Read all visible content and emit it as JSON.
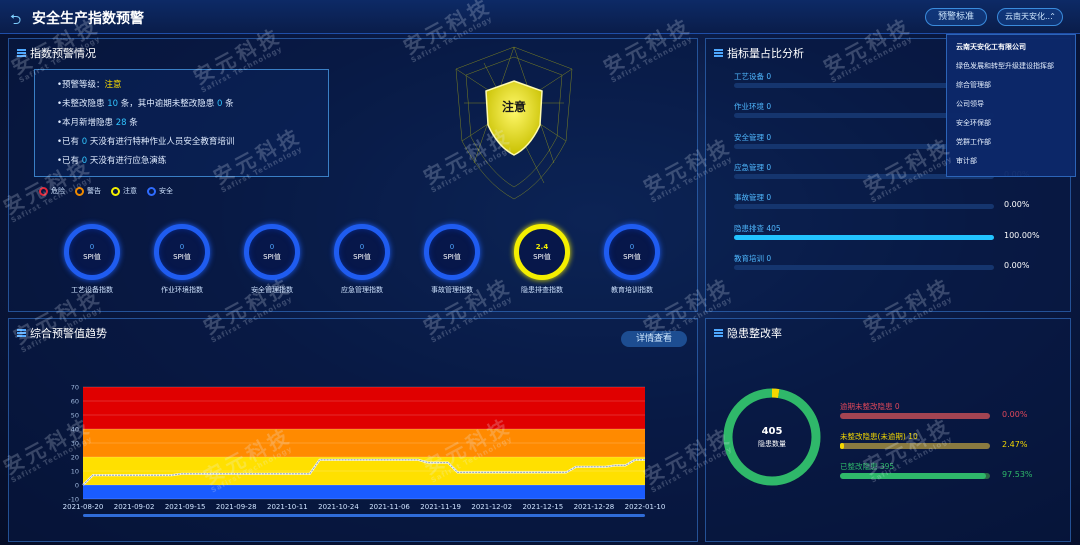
{
  "header": {
    "title": "安全生产指数预警",
    "standard_button": "预警标准",
    "company_selected": "云南天安化..."
  },
  "dropdown": {
    "items": [
      "云南天安化工有限公司",
      "绿色发展和转型升级建设指挥部",
      "综合管理部",
      "公司领导",
      "安全环保部",
      "党群工作部",
      "审计部"
    ]
  },
  "warning": {
    "title": "指数预警情况",
    "level_label": "•预警等级：",
    "level_value": "注意",
    "line2_pre": "•未整改隐患 ",
    "line2_v1": "10",
    "line2_mid": " 条，其中逾期未整改隐患 ",
    "line2_v2": "0",
    "line2_post": " 条",
    "line3_pre": "•本月新增隐患 ",
    "line3_v": "28",
    "line3_post": " 条",
    "line4_pre": "•已有 ",
    "line4_v": "0",
    "line4_post": " 天没有进行特种作业人员安全教育培训",
    "line5_pre": "•已有 ",
    "line5_v": "0",
    "line5_post": " 天没有进行应急演练",
    "shield_text": "注意",
    "legend": [
      {
        "label": "危险",
        "color": "#e0283a"
      },
      {
        "label": "警告",
        "color": "#f08a00"
      },
      {
        "label": "注意",
        "color": "#f4ef00"
      },
      {
        "label": "安全",
        "color": "#2f6cff"
      }
    ],
    "unit_label": "SPI值",
    "gauges": [
      {
        "label": "工艺设备指数",
        "value": "0"
      },
      {
        "label": "作业环境指数",
        "value": "0"
      },
      {
        "label": "安全管理指数",
        "value": "0"
      },
      {
        "label": "应急管理指数",
        "value": "0"
      },
      {
        "label": "事故管理指数",
        "value": "0"
      },
      {
        "label": "隐患排查指数",
        "value": "2.4"
      },
      {
        "label": "教育培训指数",
        "value": "0"
      }
    ]
  },
  "indicator": {
    "title": "指标量占比分析",
    "rows": [
      {
        "name": "工艺设备 0",
        "pct": "",
        "fill": 0
      },
      {
        "name": "作业环境 0",
        "pct": "",
        "fill": 0
      },
      {
        "name": "安全管理 0",
        "pct": "",
        "fill": 0
      },
      {
        "name": "应急管理 0",
        "pct": "0.00%",
        "fill": 0
      },
      {
        "name": "事故管理 0",
        "pct": "0.00%",
        "fill": 0
      },
      {
        "name": "隐患排查 405",
        "pct": "100.00%",
        "fill": 1
      },
      {
        "name": "教育培训 0",
        "pct": "0.00%",
        "fill": 0
      }
    ]
  },
  "trend": {
    "title": "综合预警值趋势",
    "detail_button": "详情查看"
  },
  "chart_data": {
    "type": "line",
    "x": [
      "2021-08-20",
      "2021-09-02",
      "2021-09-15",
      "2021-09-28",
      "2021-10-11",
      "2021-10-24",
      "2021-11-06",
      "2021-11-19",
      "2021-12-02",
      "2021-12-15",
      "2021-12-28",
      "2022-01-10"
    ],
    "ylim": [
      -10,
      70
    ],
    "yticks": [
      -10,
      0,
      10,
      20,
      30,
      40,
      50,
      60,
      70
    ],
    "bands": [
      {
        "from": -10,
        "to": 0,
        "color": "#1a5cff"
      },
      {
        "from": 0,
        "to": 20,
        "color": "#ffe000"
      },
      {
        "from": 20,
        "to": 40,
        "color": "#ff8a00"
      },
      {
        "from": 40,
        "to": 70,
        "color": "#e00000"
      }
    ],
    "series": [
      {
        "values": [
          0,
          7,
          7,
          7,
          7,
          7,
          7,
          7,
          7,
          7,
          8,
          8,
          8,
          8,
          8,
          8,
          8,
          8,
          8,
          8,
          8,
          8,
          8,
          8,
          18,
          18,
          18,
          18,
          18,
          18,
          18,
          18,
          18,
          18,
          18,
          16,
          16,
          16,
          9,
          9,
          9,
          9,
          9,
          9,
          9,
          9,
          9,
          9,
          9,
          9,
          13,
          13,
          13,
          13,
          14,
          14,
          18,
          18
        ]
      }
    ],
    "grid": true
  },
  "rectify": {
    "title": "隐患整改率",
    "donut_total": "405",
    "donut_label": "隐患数量",
    "donut_fractions": [
      0.0247,
      0.9753
    ],
    "rows": [
      {
        "name": "逾期未整改隐患 0",
        "pct": "0.00%",
        "fill": 0,
        "color": "#e0485a",
        "track": "#a34452"
      },
      {
        "name": "未整改隐患(未逾期) 10",
        "pct": "2.47%",
        "fill": 0.0247,
        "color": "#f4d800",
        "track": "#8a7a40"
      },
      {
        "name": "已整改隐患 395",
        "pct": "97.53%",
        "fill": 0.9753,
        "color": "#2fb86a",
        "track": "#2a6a45"
      }
    ]
  },
  "watermark": {
    "text": "安元科技",
    "sub": "Safirst Technology"
  }
}
